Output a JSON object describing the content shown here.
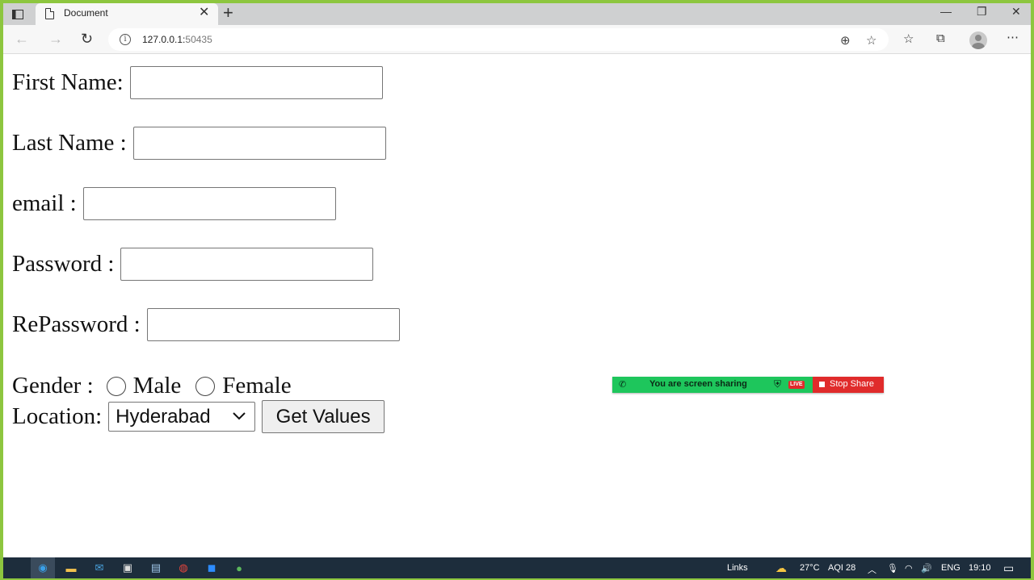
{
  "browser": {
    "tab_title": "Document",
    "new_tab_symbol": "+",
    "url_host": "127.0.0.1:",
    "url_port": "50435"
  },
  "form": {
    "first_name_label": "First Name:",
    "last_name_label": "Last Name :",
    "email_label": "email :",
    "password_label": "Password :",
    "repassword_label": "RePassword :",
    "gender_label": "Gender :",
    "gender_options": [
      "Male",
      "Female"
    ],
    "location_label": "Location:",
    "location_selected": "Hyderabad",
    "get_values_label": "Get Values"
  },
  "share_banner": {
    "message": "You are screen sharing",
    "live_badge": "LIVE",
    "stop_label": "Stop Share"
  },
  "taskbar": {
    "links_label": "Links",
    "temperature": "27°C",
    "aqi": "AQI 28",
    "language": "ENG",
    "time": "19:10"
  },
  "colors": {
    "desktop_border": "#8dc63f",
    "share_green": "#1ec65c",
    "share_red": "#e02b2b",
    "taskbar_bg": "#1d2d3c"
  }
}
